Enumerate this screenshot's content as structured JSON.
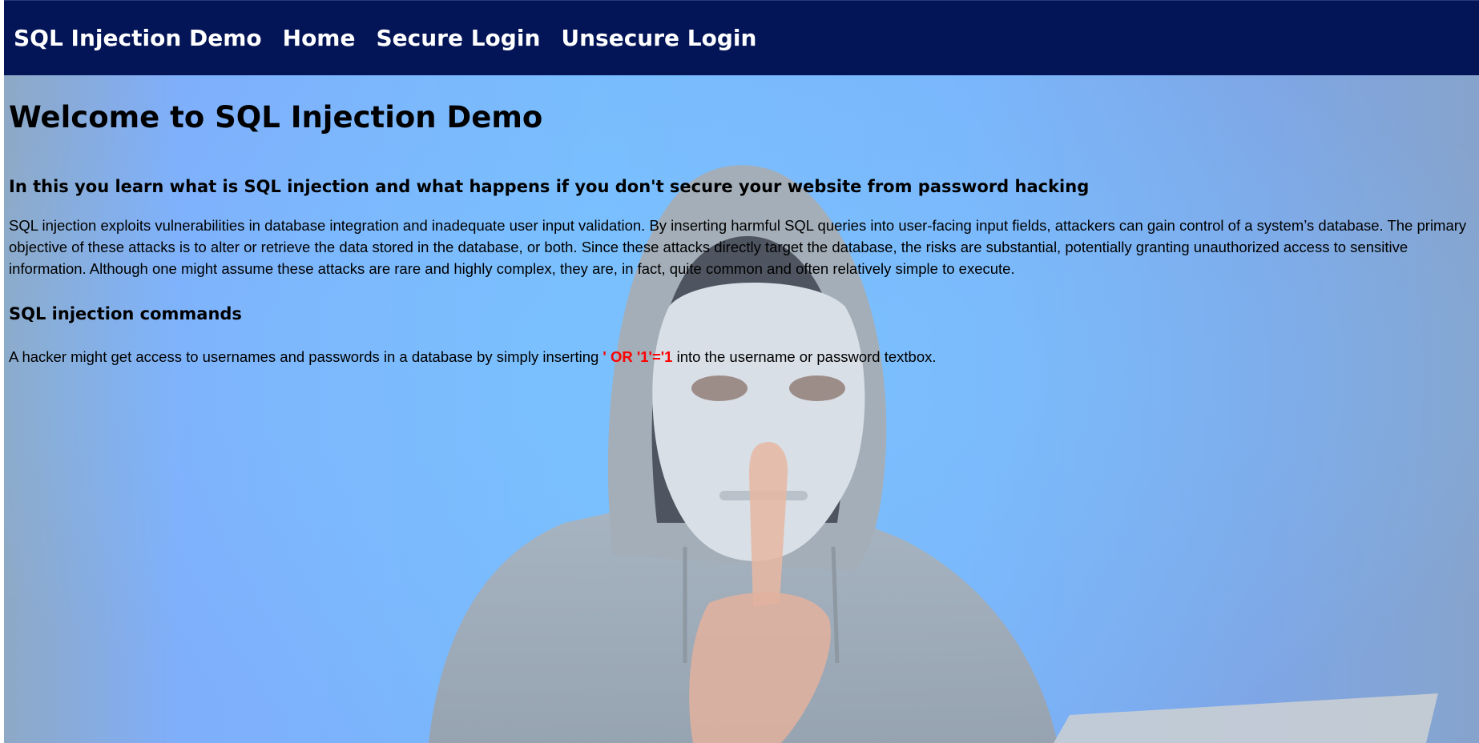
{
  "nav": {
    "brand": "SQL Injection Demo",
    "items": [
      {
        "label": "Home"
      },
      {
        "label": "Secure Login"
      },
      {
        "label": "Unsecure Login"
      }
    ],
    "background": "#031457"
  },
  "main": {
    "title": "Welcome to SQL Injection Demo",
    "subtitle": "In this you learn what is SQL injection and what happens if you don't secure your website from password hacking",
    "intro": "SQL injection exploits vulnerabilities in database integration and inadequate user input validation. By inserting harmful SQL queries into user-facing input fields, attackers can gain control of a system’s database. The primary objective of these attacks is to alter or retrieve the data stored in the database, or both. Since these attacks directly target the database, the risks are substantial, potentially granting unauthorized access to sensitive information. Although one might assume these attacks are rare and highly complex, they are, in fact, quite common and often relatively simple to execute.",
    "commands_heading": "SQL injection commands",
    "commands_before": "A hacker might get access to usernames and passwords in a database by simply inserting",
    "commands_code": "' OR '1'='1",
    "commands_after": "into the username or password textbox.",
    "highlight_color": "#ff0000"
  },
  "background_image": {
    "icon": "masked-hacker-hoodie-illustration"
  }
}
